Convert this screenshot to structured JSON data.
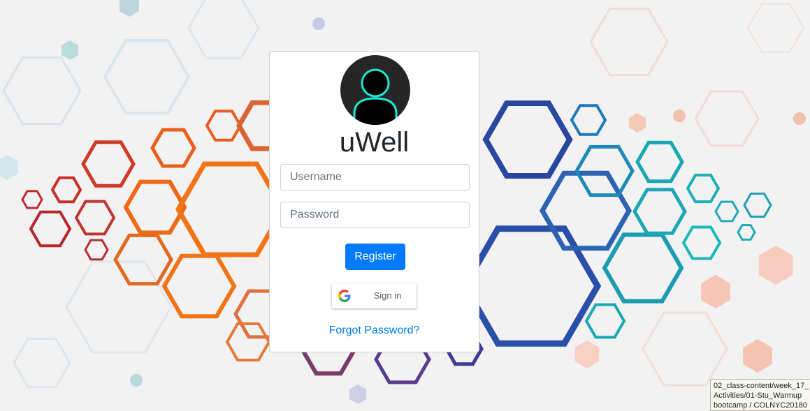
{
  "app": {
    "brand": "uWell"
  },
  "icons": {
    "avatar": "user-avatar-icon",
    "google": "google-g-icon"
  },
  "colors": {
    "primary": "#007bff",
    "avatar_bg": "#262626",
    "avatar_outline": "#1de9d6"
  },
  "form": {
    "username_placeholder": "Username",
    "password_placeholder": "Password",
    "register_label": "Register",
    "google_signin_label": "Sign in",
    "forgot_label": "Forgot Password?"
  },
  "tooltip": {
    "lines": [
      "02_class-content/week_17_",
      "Activities/01-Stu_Warmup",
      "bootcamp / COLNYC20180"
    ]
  }
}
